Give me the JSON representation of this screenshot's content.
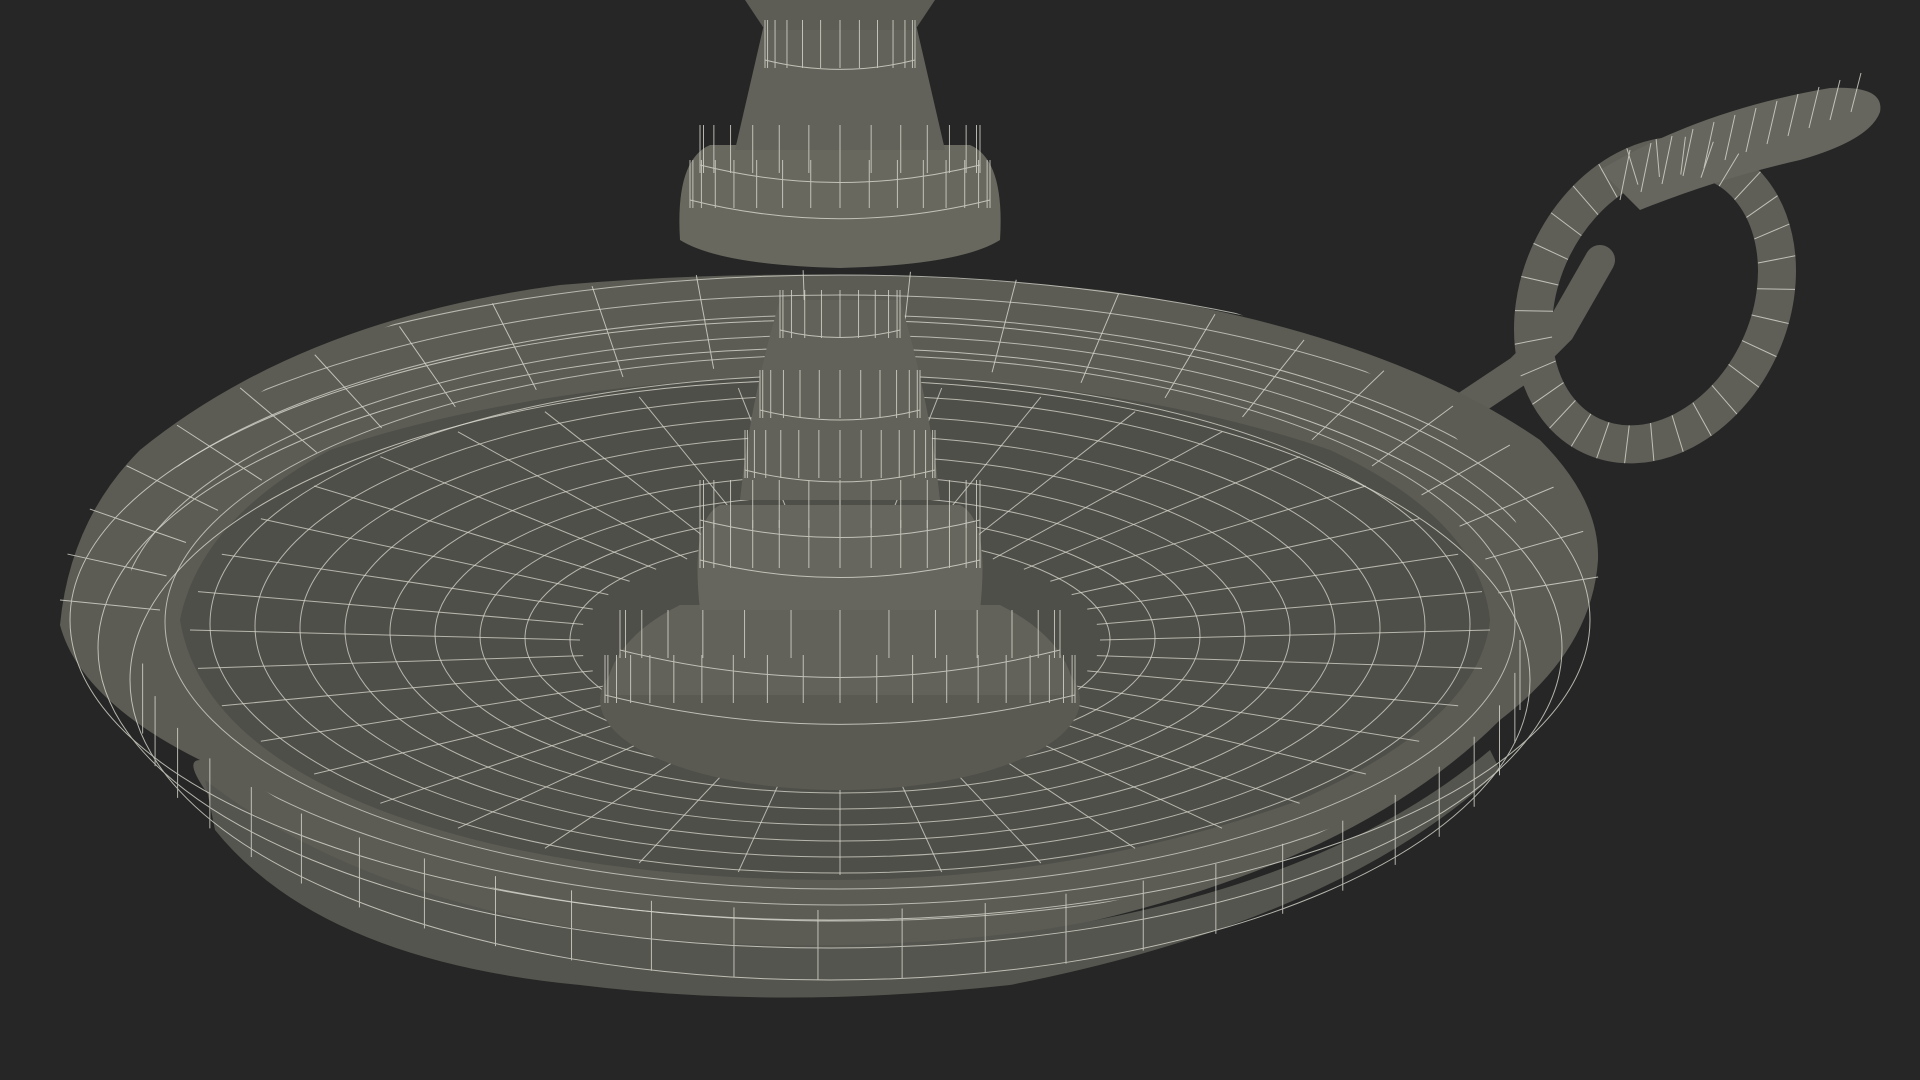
{
  "scene": {
    "background_color": "#262626",
    "surface_color": "#5f5f58",
    "surface_dark": "#4a4a44",
    "surface_light": "#74746c",
    "wire_color": "#d9d9cf",
    "wire_opacity": 0.8,
    "object": "candle-holder",
    "render_mode": "wireframe-over-shaded"
  }
}
